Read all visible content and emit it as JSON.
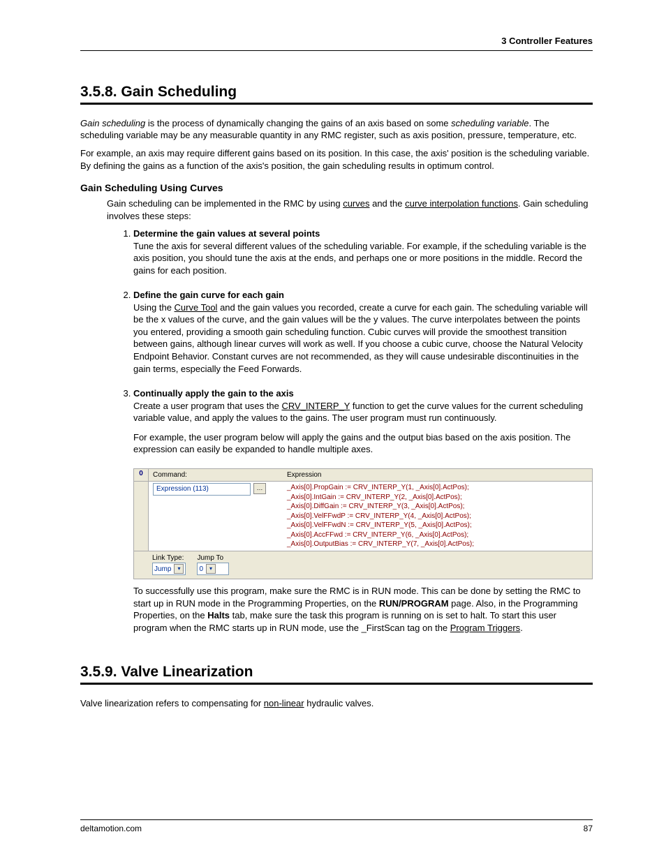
{
  "header": {
    "chapter": "3  Controller Features"
  },
  "s1": {
    "number": "3.5.8.",
    "title": "Gain Scheduling",
    "intro_p1a": "Gain scheduling",
    "intro_p1b": " is the process of dynamically changing the gains of an axis based on some ",
    "intro_p1c": "scheduling variable",
    "intro_p1d": ". The scheduling variable may be any measurable quantity in any RMC register, such as axis position, pressure, temperature, etc.",
    "intro_p2": "For example, an axis may require different gains based on its position. In this case, the axis' position is the scheduling variable. By defining the gains as a function of the axis's position, the gain scheduling results in optimum control.",
    "curves_heading": "Gain Scheduling Using Curves",
    "curves_p_a": "Gain scheduling can be implemented in the RMC by using ",
    "curves_link1": "curves",
    "curves_p_b": " and the ",
    "curves_link2": "curve interpolation functions",
    "curves_p_c": ". Gain scheduling involves these steps:",
    "steps": [
      {
        "title": "Determine the gain values at several points",
        "body": "Tune the axis for several different values of the scheduling variable. For example, if the scheduling variable is the axis position, you should tune the axis at the ends, and perhaps one or more positions in the middle. Record the gains for each position."
      },
      {
        "title": "Define the gain curve for each gain",
        "body_a": "Using the ",
        "link": "Curve Tool",
        "body_b": " and the gain values you recorded, create a curve for each gain. The scheduling variable will be the x values of the curve, and the gain values will be the y values. The curve interpolates between the points you entered, providing a smooth gain scheduling function. Cubic curves will provide the smoothest transition between gains, although linear curves will work as well. If you choose a cubic curve, choose the Natural Velocity Endpoint Behavior. Constant curves are not recommended, as they will cause undesirable discontinuities in the gain terms, especially the Feed Forwards."
      },
      {
        "title": "Continually apply the gain to the axis",
        "body_a": "Create a user program that uses the ",
        "link": "CRV_INTERP_Y",
        "body_b": " function to get the curve values for the current scheduling variable value, and apply the values to the gains. The user program must run continuously.",
        "body2": "For example, the user program below will apply the gains and the output bias based on the axis position. The expression can easily be expanded to handle multiple axes."
      }
    ],
    "table": {
      "idx": "0",
      "hdr_cmd": "Command:",
      "hdr_expr": "Expression",
      "cmd_value": "Expression (113)",
      "expr": [
        "_Axis[0].PropGain := CRV_INTERP_Y(1, _Axis[0].ActPos);",
        "_Axis[0].IntGain := CRV_INTERP_Y(2, _Axis[0].ActPos);",
        "_Axis[0].DiffGain := CRV_INTERP_Y(3, _Axis[0].ActPos);",
        "_Axis[0].VelFFwdP := CRV_INTERP_Y(4, _Axis[0].ActPos);",
        "_Axis[0].VelFFwdN := CRV_INTERP_Y(5, _Axis[0].ActPos);",
        "_Axis[0].AccFFwd := CRV_INTERP_Y(6, _Axis[0].ActPos);",
        "_Axis[0].OutputBias := CRV_INTERP_Y(7, _Axis[0].ActPos);"
      ],
      "link_type_label": "Link Type:",
      "link_type_value": "Jump",
      "jump_to_label": "Jump To",
      "jump_to_value": "0"
    },
    "after_a": "To successfully use this program, make sure the RMC is in RUN mode. This can be done by setting the RMC to start up in RUN mode in the Programming Properties, on the ",
    "after_b": "RUN/PROGRAM",
    "after_c": " page. Also, in the Programming Properties, on the ",
    "after_d": "Halts",
    "after_e": " tab, make sure the task this program is running on is set to halt. To start this user program when the RMC starts up in RUN mode, use the _FirstScan tag on the ",
    "after_link": "Program Triggers",
    "after_f": "."
  },
  "s2": {
    "number": "3.5.9.",
    "title": "Valve Linearization",
    "p1a": "Valve linearization refers to compensating for ",
    "p1link": "non-linear",
    "p1b": " hydraulic valves."
  },
  "footer": {
    "left": "deltamotion.com",
    "right": "87"
  }
}
